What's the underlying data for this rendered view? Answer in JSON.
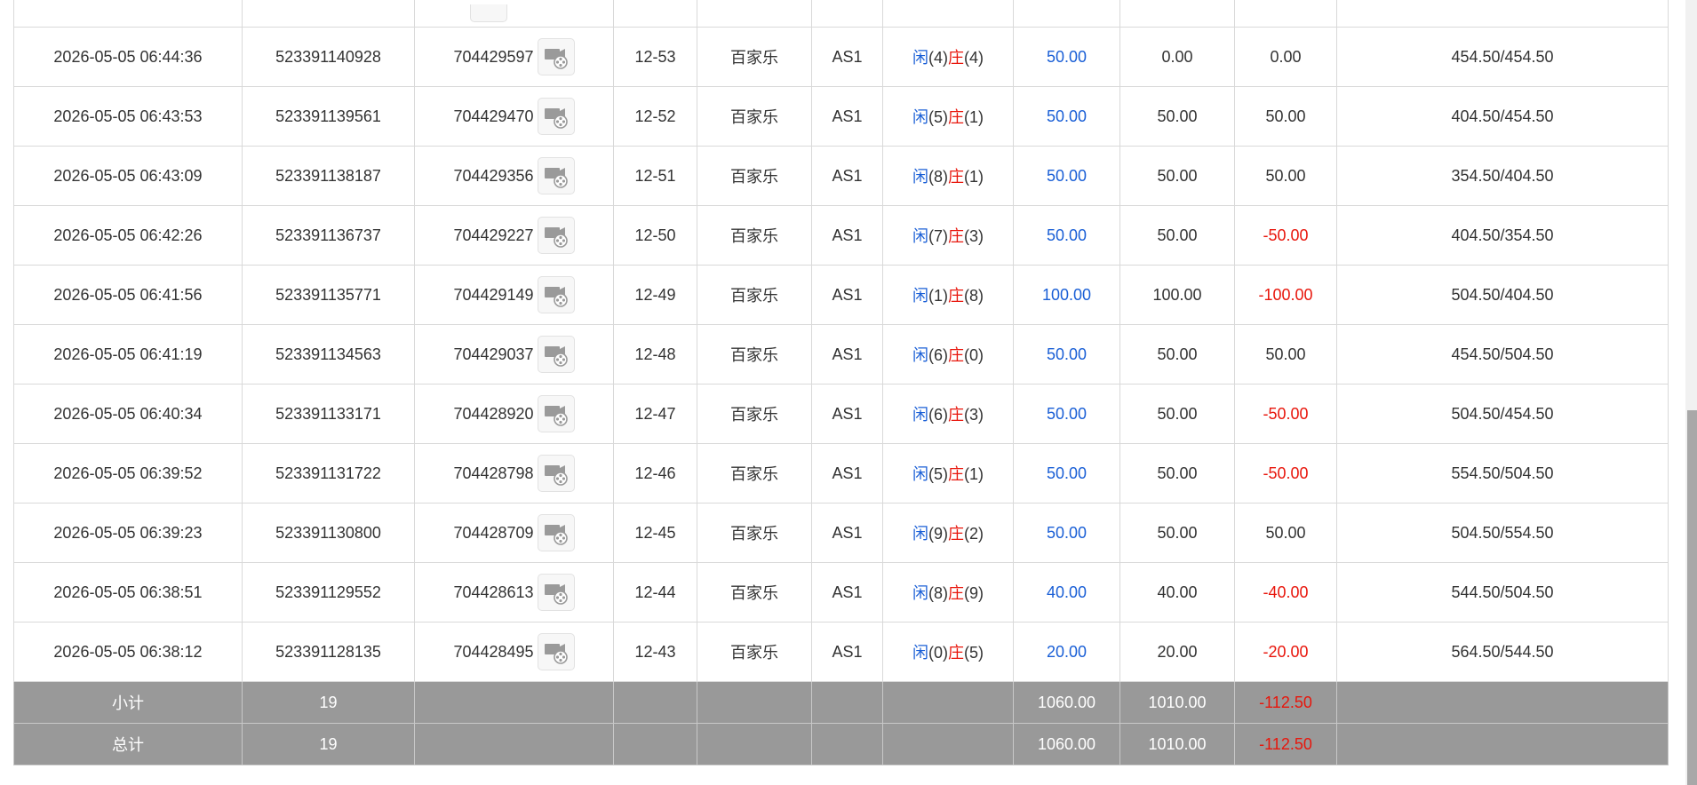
{
  "rows": [
    {
      "time": "2026-05-05 06:44:36",
      "order_id": "523391140928",
      "round_id": "704429597",
      "shoe": "12-53",
      "game": "百家乐",
      "table": "AS1",
      "player_label": "闲",
      "player_pts": "(4)",
      "banker_label": "庄",
      "banker_pts": "(4)",
      "bet": "50.00",
      "valid": "0.00",
      "win": "0.00",
      "balance": "454.50/454.50"
    },
    {
      "time": "2026-05-05 06:43:53",
      "order_id": "523391139561",
      "round_id": "704429470",
      "shoe": "12-52",
      "game": "百家乐",
      "table": "AS1",
      "player_label": "闲",
      "player_pts": "(5)",
      "banker_label": "庄",
      "banker_pts": "(1)",
      "bet": "50.00",
      "valid": "50.00",
      "win": "50.00",
      "balance": "404.50/454.50"
    },
    {
      "time": "2026-05-05 06:43:09",
      "order_id": "523391138187",
      "round_id": "704429356",
      "shoe": "12-51",
      "game": "百家乐",
      "table": "AS1",
      "player_label": "闲",
      "player_pts": "(8)",
      "banker_label": "庄",
      "banker_pts": "(1)",
      "bet": "50.00",
      "valid": "50.00",
      "win": "50.00",
      "balance": "354.50/404.50"
    },
    {
      "time": "2026-05-05 06:42:26",
      "order_id": "523391136737",
      "round_id": "704429227",
      "shoe": "12-50",
      "game": "百家乐",
      "table": "AS1",
      "player_label": "闲",
      "player_pts": "(7)",
      "banker_label": "庄",
      "banker_pts": "(3)",
      "bet": "50.00",
      "valid": "50.00",
      "win": "-50.00",
      "balance": "404.50/354.50"
    },
    {
      "time": "2026-05-05 06:41:56",
      "order_id": "523391135771",
      "round_id": "704429149",
      "shoe": "12-49",
      "game": "百家乐",
      "table": "AS1",
      "player_label": "闲",
      "player_pts": "(1)",
      "banker_label": "庄",
      "banker_pts": "(8)",
      "bet": "100.00",
      "valid": "100.00",
      "win": "-100.00",
      "balance": "504.50/404.50"
    },
    {
      "time": "2026-05-05 06:41:19",
      "order_id": "523391134563",
      "round_id": "704429037",
      "shoe": "12-48",
      "game": "百家乐",
      "table": "AS1",
      "player_label": "闲",
      "player_pts": "(6)",
      "banker_label": "庄",
      "banker_pts": "(0)",
      "bet": "50.00",
      "valid": "50.00",
      "win": "50.00",
      "balance": "454.50/504.50"
    },
    {
      "time": "2026-05-05 06:40:34",
      "order_id": "523391133171",
      "round_id": "704428920",
      "shoe": "12-47",
      "game": "百家乐",
      "table": "AS1",
      "player_label": "闲",
      "player_pts": "(6)",
      "banker_label": "庄",
      "banker_pts": "(3)",
      "bet": "50.00",
      "valid": "50.00",
      "win": "-50.00",
      "balance": "504.50/454.50"
    },
    {
      "time": "2026-05-05 06:39:52",
      "order_id": "523391131722",
      "round_id": "704428798",
      "shoe": "12-46",
      "game": "百家乐",
      "table": "AS1",
      "player_label": "闲",
      "player_pts": "(5)",
      "banker_label": "庄",
      "banker_pts": "(1)",
      "bet": "50.00",
      "valid": "50.00",
      "win": "-50.00",
      "balance": "554.50/504.50"
    },
    {
      "time": "2026-05-05 06:39:23",
      "order_id": "523391130800",
      "round_id": "704428709",
      "shoe": "12-45",
      "game": "百家乐",
      "table": "AS1",
      "player_label": "闲",
      "player_pts": "(9)",
      "banker_label": "庄",
      "banker_pts": "(2)",
      "bet": "50.00",
      "valid": "50.00",
      "win": "50.00",
      "balance": "504.50/554.50"
    },
    {
      "time": "2026-05-05 06:38:51",
      "order_id": "523391129552",
      "round_id": "704428613",
      "shoe": "12-44",
      "game": "百家乐",
      "table": "AS1",
      "player_label": "闲",
      "player_pts": "(8)",
      "banker_label": "庄",
      "banker_pts": "(9)",
      "bet": "40.00",
      "valid": "40.00",
      "win": "-40.00",
      "balance": "544.50/504.50"
    },
    {
      "time": "2026-05-05 06:38:12",
      "order_id": "523391128135",
      "round_id": "704428495",
      "shoe": "12-43",
      "game": "百家乐",
      "table": "AS1",
      "player_label": "闲",
      "player_pts": "(0)",
      "banker_label": "庄",
      "banker_pts": "(5)",
      "bet": "20.00",
      "valid": "20.00",
      "win": "-20.00",
      "balance": "564.50/544.50"
    }
  ],
  "subtotal": {
    "label": "小计",
    "count": "19",
    "bet": "1060.00",
    "valid": "1010.00",
    "win": "-112.50"
  },
  "total": {
    "label": "总计",
    "count": "19",
    "bet": "1060.00",
    "valid": "1010.00",
    "win": "-112.50"
  },
  "icons": {
    "replay": "video-replay-icon"
  },
  "colors": {
    "player": "#1a5fd6",
    "banker": "#e8160c",
    "bet": "#1a5fd6",
    "negative": "#e8160c",
    "summary_bg": "#999999"
  }
}
